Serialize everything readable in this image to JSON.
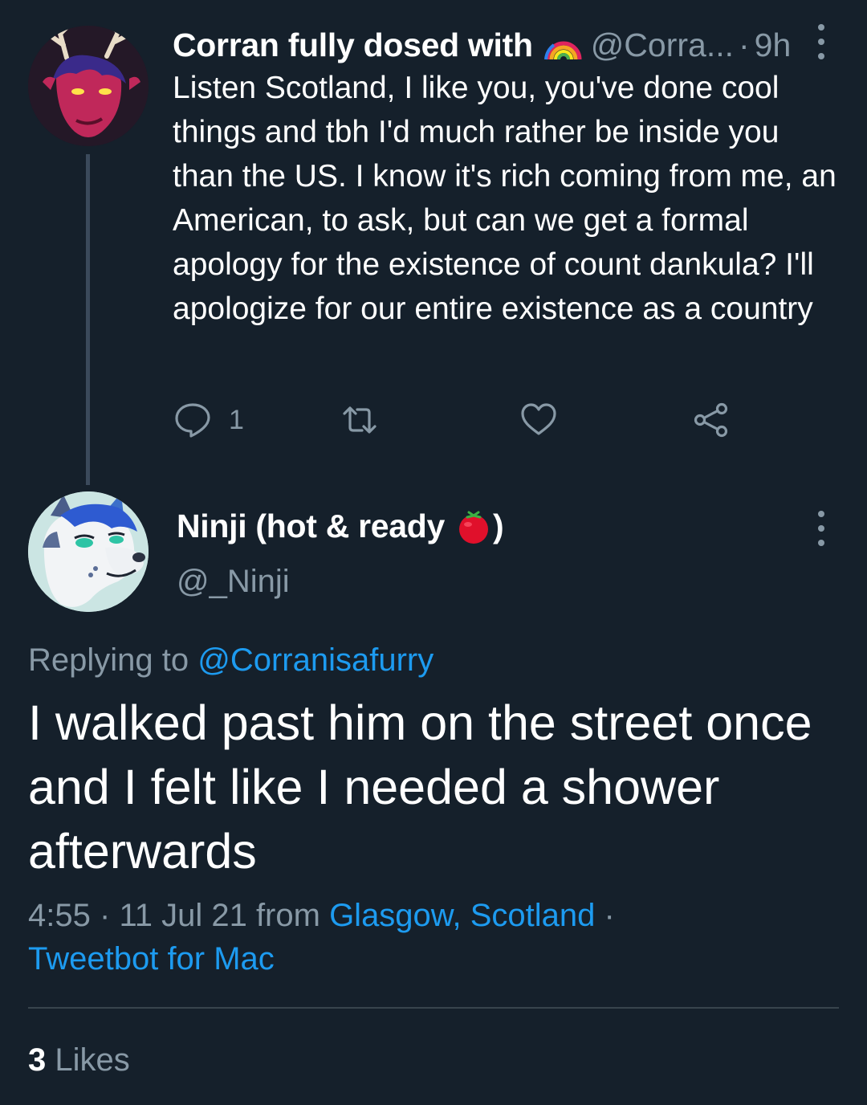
{
  "colors": {
    "background": "#15202b",
    "secondary_text": "#8899a6",
    "link": "#1d9bf0",
    "divider": "#38444d"
  },
  "tweet1": {
    "display_name": "Corran fully dosed with",
    "name_emoji": "rainbow-icon",
    "handle": "@Corra...",
    "separator": "·",
    "time": "9h",
    "body": "Listen Scotland, I like you, you've done cool things and tbh I'd much rather be inside you than the US. I know it's rich coming from me, an American, to ask, but can we get a formal apology for the existence of count dankula? I'll apologize for our entire existence as a country",
    "actions": {
      "reply_icon": "reply-icon",
      "reply_count": "1",
      "retweet_icon": "retweet-icon",
      "like_icon": "heart-icon",
      "share_icon": "share-icon"
    }
  },
  "tweet2": {
    "display_name_before": "Ninji (hot & ready",
    "name_emoji": "tomato-icon",
    "display_name_after": ")",
    "handle": "@_Ninji",
    "replying_prefix": "Replying to",
    "replying_to": "@Corranisafurry",
    "body": "I walked past him on the street once and I felt like I needed a shower afterwards",
    "time": "4:55",
    "date": "11 Jul 21",
    "from_label": "from",
    "location": "Glasgow, Scotland",
    "client": "Tweetbot for Mac",
    "likes_count": "3",
    "likes_label": "Likes"
  }
}
